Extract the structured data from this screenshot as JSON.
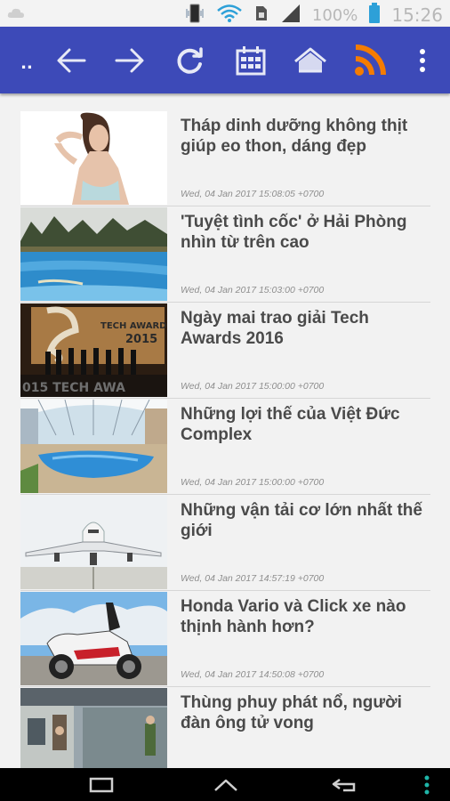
{
  "status_bar": {
    "battery_percent": "100%",
    "time": "15:26",
    "icons": [
      "notification-icon",
      "vibrate-icon",
      "wifi-icon",
      "sim-icon",
      "signal-icon",
      "battery-icon"
    ]
  },
  "toolbar": {
    "overflow_left_label": "..",
    "accent_color": "#3d4ab8",
    "rss_color": "#f57c00",
    "icons": [
      "back-icon",
      "forward-icon",
      "refresh-icon",
      "calendar-icon",
      "home-icon",
      "rss-icon",
      "more-vert-icon"
    ]
  },
  "news": [
    {
      "title": "Tháp dinh dưỡng không thịt giúp eo thon, dáng đẹp",
      "time": "Wed, 04 Jan 2017 15:08:05 +0700"
    },
    {
      "title": "'Tuyệt tình cốc' ở Hải Phòng nhìn từ trên cao",
      "time": "Wed, 04 Jan 2017 15:03:00 +0700"
    },
    {
      "title": "Ngày mai trao giải Tech Awards 2016",
      "time": "Wed, 04 Jan 2017 15:00:00 +0700"
    },
    {
      "title": "Những lợi thế của Việt Đức Complex",
      "time": "Wed, 04 Jan 2017 15:00:00 +0700"
    },
    {
      "title": "Những vận tải cơ lớn nhất thế giới",
      "time": "Wed, 04 Jan 2017 14:57:19 +0700"
    },
    {
      "title": "Honda Vario và Click xe nào thịnh hành hơn?",
      "time": "Wed, 04 Jan 2017 14:50:08 +0700"
    },
    {
      "title": "Thùng phuy phát nổ, người đàn ông tử vong",
      "time": ""
    }
  ],
  "thumb_text": {
    "tech_awards_banner": "TECH AWARDS",
    "tech_awards_year": "2015",
    "tech_awards_bottom": "015 TECH AWA"
  },
  "nav_bar": {
    "icons": [
      "recent-apps-icon",
      "home-nav-icon",
      "back-nav-icon",
      "menu-dots-icon"
    ]
  }
}
